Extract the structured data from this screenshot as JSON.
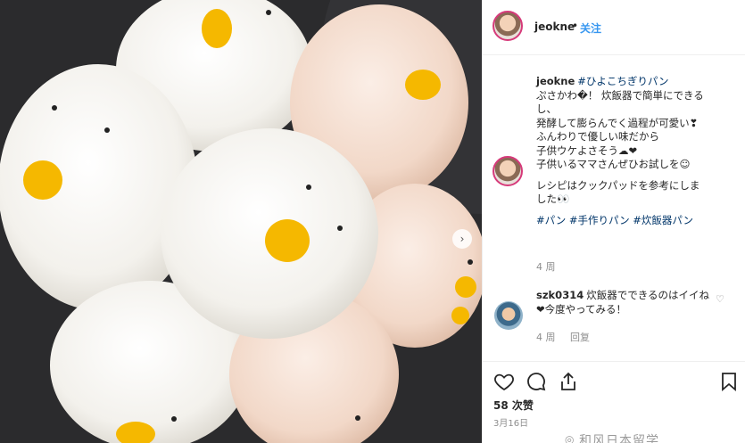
{
  "post": {
    "username": "jeokne",
    "separator": "•",
    "follow_label": "关注"
  },
  "caption": {
    "username": "jeokne",
    "lines": [
      "#ひよこちぎりパン",
      "ぷさかわ�！ 炊飯器で簡単にできる",
      "し、",
      "発酵して膨らんでく過程が可愛い❣",
      "ふんわりで優しい味だから",
      "子供ウケよさそう☁❤",
      "子供いるママさんぜひお試しを☺",
      "レシピはクックパッドを参考にしま",
      "した👀",
      "#パン #手作りパン #炊飯器パン"
    ],
    "time": "4 周"
  },
  "comment": {
    "username": "szk0314",
    "text": "炊飯器でできるのはイイね❤今度やってみる！",
    "time": "4 周",
    "reply_label": "回复"
  },
  "stats": {
    "likes": "58 次赞",
    "date": "3月16日"
  },
  "watermark": "和风日本留学",
  "icons": {
    "like": "heart-icon",
    "comment": "comment-icon",
    "share": "share-icon",
    "save": "bookmark-icon",
    "next": "chevron-right-icon"
  }
}
